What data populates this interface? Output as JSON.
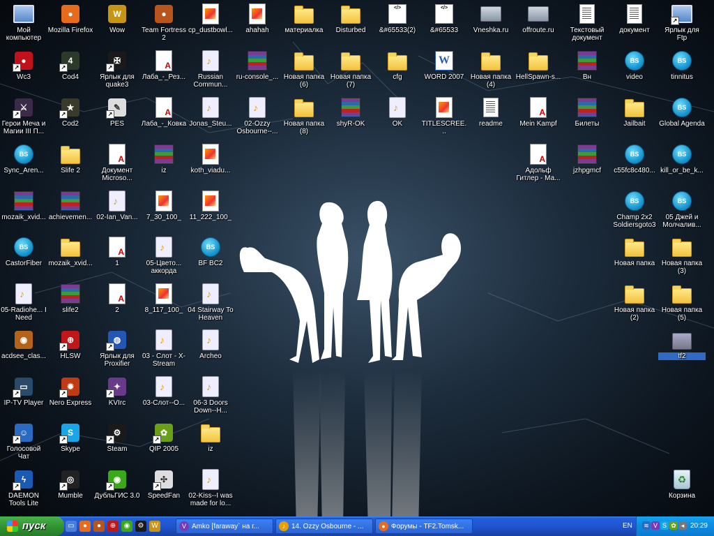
{
  "desktop_icons": [
    {
      "label": "Мой компьютер",
      "icon": "computer-icon",
      "type": "pc",
      "shortcut": false
    },
    {
      "label": "Mozilla Firefox",
      "icon": "firefox-icon",
      "type": "app",
      "color": "#e76b1d",
      "glyph": "●",
      "shortcut": false
    },
    {
      "label": "Wow",
      "icon": "wow-icon",
      "type": "app",
      "color": "#c79515",
      "glyph": "W",
      "shortcut": false
    },
    {
      "label": "Team Fortress 2",
      "icon": "tf2-icon",
      "type": "app",
      "color": "#b8551c",
      "glyph": "●",
      "shortcut": false
    },
    {
      "label": "cp_dustbowl...",
      "icon": "file-icon",
      "type": "img",
      "shortcut": false
    },
    {
      "label": "ahahah",
      "icon": "file-icon",
      "type": "img",
      "shortcut": false
    },
    {
      "label": "материалка",
      "icon": "folder-icon",
      "type": "folder",
      "shortcut": false
    },
    {
      "label": "Disturbed",
      "icon": "folder-icon",
      "type": "folder",
      "shortcut": false
    },
    {
      "label": "&#65533(2)",
      "icon": "html-icon",
      "type": "html",
      "shortcut": false
    },
    {
      "label": "&#65533",
      "icon": "html-icon",
      "type": "html",
      "shortcut": false
    },
    {
      "label": "Vneshka.ru",
      "icon": "network-icon",
      "type": "net",
      "shortcut": false
    },
    {
      "label": "offroute.ru",
      "icon": "network-icon",
      "type": "net",
      "shortcut": false
    },
    {
      "label": "Текстовый документ",
      "icon": "text-doc-icon",
      "type": "txt",
      "shortcut": false
    },
    {
      "label": "документ",
      "icon": "text-doc-icon",
      "type": "txt",
      "shortcut": false
    },
    {
      "label": "Ярлык для Ftp",
      "icon": "computer-icon",
      "type": "pc",
      "shortcut": true
    },
    {
      "label": "Wc3",
      "icon": "wc3-icon",
      "type": "app",
      "color": "#c0121a",
      "glyph": "●",
      "shortcut": true
    },
    {
      "label": "Cod4",
      "icon": "cod4-icon",
      "type": "app",
      "color": "#2c3a2a",
      "glyph": "4",
      "shortcut": true
    },
    {
      "label": "Ярлык для quake3",
      "icon": "quake-icon",
      "type": "app",
      "color": "#1a1a1a",
      "glyph": "✠",
      "shortcut": true
    },
    {
      "label": "Лаба_-_Рез...",
      "icon": "pdf-icon",
      "type": "pdf",
      "shortcut": false
    },
    {
      "label": "Russian Commun...",
      "icon": "media-icon",
      "type": "media",
      "shortcut": false
    },
    {
      "label": "ru-console_...",
      "icon": "archive-icon",
      "type": "rar",
      "shortcut": false
    },
    {
      "label": "Новая папка (6)",
      "icon": "folder-icon",
      "type": "folder",
      "shortcut": false
    },
    {
      "label": "Новая папка (7)",
      "icon": "folder-icon",
      "type": "folder",
      "shortcut": false
    },
    {
      "label": "cfg",
      "icon": "folder-icon",
      "type": "folder",
      "shortcut": false
    },
    {
      "label": "WORD 2007",
      "icon": "word-icon",
      "type": "word",
      "shortcut": false
    },
    {
      "label": "Новая папка (4)",
      "icon": "folder-icon",
      "type": "folder",
      "shortcut": false
    },
    {
      "label": "HellSpawn-s...",
      "icon": "folder-icon",
      "type": "folder",
      "shortcut": false
    },
    {
      "label": "Вн",
      "icon": "archive-icon",
      "type": "rar",
      "shortcut": false
    },
    {
      "label": "video",
      "icon": "bsplayer-icon",
      "type": "bs",
      "shortcut": false
    },
    {
      "label": "tinnitus",
      "icon": "bsplayer-icon",
      "type": "bs",
      "shortcut": false
    },
    {
      "label": "Герои Меча и Магии III П...",
      "icon": "heroes-icon",
      "type": "app",
      "color": "#3b2a4a",
      "glyph": "⚔",
      "shortcut": true
    },
    {
      "label": "Cod2",
      "icon": "cod2-icon",
      "type": "app",
      "color": "#3a3a2a",
      "glyph": "★",
      "shortcut": true
    },
    {
      "label": "PES",
      "icon": "pes-icon",
      "type": "app",
      "color": "#dddddd",
      "glyph": "✎",
      "shortcut": true
    },
    {
      "label": "Лаба_-_Ковка",
      "icon": "pdf-icon",
      "type": "pdf",
      "shortcut": false
    },
    {
      "label": "Jonas_Steu...",
      "icon": "media-icon",
      "type": "media",
      "shortcut": false
    },
    {
      "label": "02-Ozzy Osbourne--...",
      "icon": "media-icon",
      "type": "media",
      "shortcut": false
    },
    {
      "label": "Новая папка (8)",
      "icon": "folder-icon",
      "type": "folder",
      "shortcut": false
    },
    {
      "label": "shyR-OK",
      "icon": "archive-icon",
      "type": "rar",
      "shortcut": false
    },
    {
      "label": "OK",
      "icon": "media-icon",
      "type": "media",
      "shortcut": false
    },
    {
      "label": "TITLESCREE...",
      "icon": "file-icon",
      "type": "img",
      "shortcut": false
    },
    {
      "label": "readme",
      "icon": "text-doc-icon",
      "type": "txt",
      "shortcut": false
    },
    {
      "label": "Mein Kampf",
      "icon": "pdf-icon",
      "type": "pdf",
      "shortcut": false
    },
    {
      "label": "Билеты",
      "icon": "archive-icon",
      "type": "rar",
      "shortcut": false
    },
    {
      "label": "Jailbait",
      "icon": "folder-icon",
      "type": "folder",
      "shortcut": false
    },
    {
      "label": "Global Agenda",
      "icon": "bsplayer-icon",
      "type": "bs",
      "shortcut": false
    },
    {
      "label": "Sync_Aren...",
      "icon": "bsplayer-icon",
      "type": "bs",
      "shortcut": false
    },
    {
      "label": "Slife 2",
      "icon": "folder-icon",
      "type": "folder",
      "shortcut": false
    },
    {
      "label": "Документ Microso...",
      "icon": "pdf-icon",
      "type": "pdf",
      "shortcut": false
    },
    {
      "label": "iz",
      "icon": "archive-icon",
      "type": "rar",
      "shortcut": false
    },
    {
      "label": "koth_viadu...",
      "icon": "file-icon",
      "type": "img",
      "shortcut": false
    },
    {
      "label": "Адольф Гитлер - Ма...",
      "icon": "pdf-icon",
      "type": "pdf",
      "shortcut": false
    },
    {
      "label": "jzhpgmcf",
      "icon": "archive-icon",
      "type": "rar",
      "shortcut": false
    },
    {
      "label": "c55fc8c480...",
      "icon": "bsplayer-icon",
      "type": "bs",
      "shortcut": false
    },
    {
      "label": "kill_or_be_k...",
      "icon": "bsplayer-icon",
      "type": "bs",
      "shortcut": false
    },
    {
      "label": "mozaik_xvid...",
      "icon": "archive-icon",
      "type": "rar",
      "shortcut": false
    },
    {
      "label": "achievemen...",
      "icon": "archive-icon",
      "type": "rar",
      "shortcut": false
    },
    {
      "label": "02-Ian_Van...",
      "icon": "media-icon",
      "type": "media",
      "shortcut": false
    },
    {
      "label": "7_30_100_",
      "icon": "file-icon",
      "type": "img",
      "shortcut": false
    },
    {
      "label": "11_222_100_",
      "icon": "image-icon",
      "type": "img2",
      "shortcut": false
    },
    {
      "label": "Champ 2x2 Soldiersgoto3",
      "icon": "bsplayer-icon",
      "type": "bs",
      "shortcut": false
    },
    {
      "label": "05 Джей и Молчалив...",
      "icon": "bsplayer-icon",
      "type": "bs",
      "shortcut": false
    },
    {
      "label": "CastorFiber",
      "icon": "bsplayer-icon",
      "type": "bs",
      "shortcut": false
    },
    {
      "label": "mozaik_xvid...",
      "icon": "folder-icon",
      "type": "folder",
      "shortcut": false
    },
    {
      "label": "1",
      "icon": "pdf-icon",
      "type": "pdf",
      "shortcut": false
    },
    {
      "label": "05-Цвето... аккорда",
      "icon": "media-icon",
      "type": "media",
      "shortcut": false
    },
    {
      "label": "BF BC2",
      "icon": "bsplayer-icon",
      "type": "bs",
      "shortcut": false
    },
    {
      "label": "Новая папка",
      "icon": "folder-icon",
      "type": "folder",
      "shortcut": false
    },
    {
      "label": "Новая папка (3)",
      "icon": "folder-icon",
      "type": "folder",
      "shortcut": false
    },
    {
      "label": "05-Radiohe... I Need",
      "icon": "media-icon",
      "type": "media",
      "shortcut": false
    },
    {
      "label": "slife2",
      "icon": "archive-icon",
      "type": "rar",
      "shortcut": false
    },
    {
      "label": "2",
      "icon": "pdf-icon",
      "type": "pdf",
      "shortcut": false
    },
    {
      "label": "8_117_100_",
      "icon": "image-icon",
      "type": "img2",
      "shortcut": false
    },
    {
      "label": "04 Stairway To Heaven",
      "icon": "media-icon",
      "type": "media",
      "shortcut": false
    },
    {
      "label": "Новая папка (2)",
      "icon": "folder-icon",
      "type": "folder",
      "shortcut": false
    },
    {
      "label": "Новая папка (5)",
      "icon": "folder-icon",
      "type": "folder",
      "shortcut": false
    },
    {
      "label": "acdsee_clas...",
      "icon": "acdsee-icon",
      "type": "app",
      "color": "#b4641a",
      "glyph": "◉",
      "shortcut": false
    },
    {
      "label": "HLSW",
      "icon": "hlsw-icon",
      "type": "app",
      "color": "#c01818",
      "glyph": "⊕",
      "shortcut": true
    },
    {
      "label": "Ярлык для Proxifier",
      "icon": "proxifier-icon",
      "type": "app",
      "color": "#2456b4",
      "glyph": "◍",
      "shortcut": true
    },
    {
      "label": "03 - Слот - X-Stream",
      "icon": "media-icon",
      "type": "media",
      "shortcut": false
    },
    {
      "label": "Archeo",
      "icon": "media-icon",
      "type": "media",
      "shortcut": false
    },
    {
      "label": "tf2",
      "icon": "tf2-folder-icon",
      "type": "tf",
      "shortcut": false
    },
    {
      "label": "IP-TV Player",
      "icon": "iptv-icon",
      "type": "app",
      "color": "#2a4a6a",
      "glyph": "▭",
      "shortcut": true
    },
    {
      "label": "Nero Express",
      "icon": "nero-icon",
      "type": "app",
      "color": "#c03a14",
      "glyph": "✹",
      "shortcut": true
    },
    {
      "label": "KVIrc",
      "icon": "kvirc-icon",
      "type": "app",
      "color": "#6a3a8a",
      "glyph": "✦",
      "shortcut": true
    },
    {
      "label": "03-Слот--О...",
      "icon": "media-icon",
      "type": "media",
      "shortcut": false
    },
    {
      "label": "06-3 Doors Down--H...",
      "icon": "media-icon",
      "type": "media",
      "shortcut": false
    },
    {
      "label": "Голосовой Чат",
      "icon": "voice-chat-icon",
      "type": "app",
      "color": "#2a6ac0",
      "glyph": "☺",
      "shortcut": true
    },
    {
      "label": "Skype",
      "icon": "skype-icon",
      "type": "app",
      "color": "#18a6e8",
      "glyph": "S",
      "shortcut": true
    },
    {
      "label": "Steam",
      "icon": "steam-icon",
      "type": "app",
      "color": "#1a1a1a",
      "glyph": "⚙",
      "shortcut": true
    },
    {
      "label": "QIP 2005",
      "icon": "qip-icon",
      "type": "app",
      "color": "#6aa018",
      "glyph": "✿",
      "shortcut": true
    },
    {
      "label": "iz",
      "icon": "folder-icon",
      "type": "folder",
      "shortcut": false
    },
    {
      "label": "DAEMON Tools Lite",
      "icon": "daemon-tools-icon",
      "type": "app",
      "color": "#1a5ab4",
      "glyph": "ϟ",
      "shortcut": true
    },
    {
      "label": "Mumble",
      "icon": "mumble-icon",
      "type": "app",
      "color": "#222222",
      "glyph": "◎",
      "shortcut": true
    },
    {
      "label": "ДубльГИС 3.0",
      "icon": "2gis-icon",
      "type": "app",
      "color": "#3aa818",
      "glyph": "◉",
      "shortcut": true
    },
    {
      "label": "SpeedFan",
      "icon": "speedfan-icon",
      "type": "app",
      "color": "#dddddd",
      "glyph": "✣",
      "shortcut": true
    },
    {
      "label": "02-Kiss--I was made for lo...",
      "icon": "media-icon",
      "type": "media",
      "shortcut": false
    },
    {
      "label": "Корзина",
      "icon": "recycle-bin-icon",
      "type": "recycle",
      "shortcut": false
    }
  ],
  "taskbar": {
    "start_label": "пуск",
    "quick_launch": [
      {
        "name": "show-desktop-icon",
        "color": "#4a7fd8",
        "glyph": "▭"
      },
      {
        "name": "firefox-icon",
        "color": "#e76b1d",
        "glyph": "●"
      },
      {
        "name": "tf2-icon",
        "color": "#b8551c",
        "glyph": "●"
      },
      {
        "name": "hlsw-icon",
        "color": "#c01818",
        "glyph": "⊕"
      },
      {
        "name": "2gis-icon",
        "color": "#3aa818",
        "glyph": "◉"
      },
      {
        "name": "steam-icon",
        "color": "#1a1a1a",
        "glyph": "⚙"
      },
      {
        "name": "wow-icon",
        "color": "#c79515",
        "glyph": "W"
      }
    ],
    "windows": [
      {
        "label": "Amko [faraway` на г...",
        "icon": "ventrilo-icon",
        "color": "#7a3ab8",
        "glyph": "V"
      },
      {
        "label": "14. Ozzy Osbourne - ...",
        "icon": "media-icon",
        "color": "#e8a000",
        "glyph": "♪"
      },
      {
        "label": "Форумы - TF2.Tomsk...",
        "icon": "firefox-icon",
        "color": "#e76b1d",
        "glyph": "●"
      }
    ],
    "language": "EN",
    "tray": [
      {
        "name": "network-tray-icon",
        "color": "#2a6ac0",
        "glyph": "≋"
      },
      {
        "name": "ventrilo-tray-icon",
        "color": "#7a3ab8",
        "glyph": "V"
      },
      {
        "name": "skype-tray-icon",
        "color": "#18a6e8",
        "glyph": "S"
      },
      {
        "name": "qip-tray-icon",
        "color": "#6aa018",
        "glyph": "✿"
      },
      {
        "name": "speaker-tray-icon",
        "color": "#777777",
        "glyph": "◂"
      }
    ],
    "clock": "20:29"
  }
}
